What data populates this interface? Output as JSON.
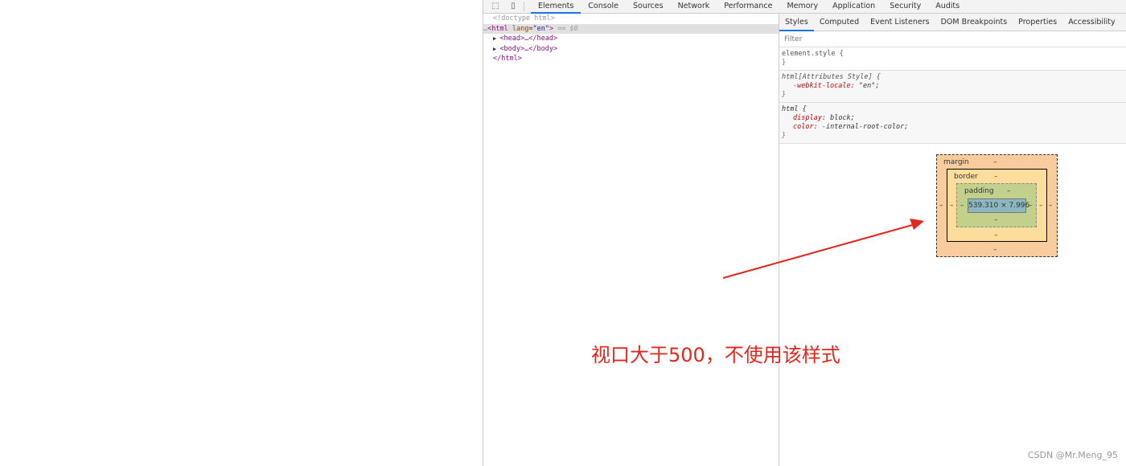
{
  "toolbar": {
    "icons": [
      "inspect-icon",
      "device-toggle-icon"
    ],
    "tabs": [
      "Elements",
      "Console",
      "Sources",
      "Network",
      "Performance",
      "Memory",
      "Application",
      "Security",
      "Audits"
    ],
    "active": "Elements"
  },
  "elements": {
    "doctype": "<!doctype html>",
    "html_open": "<html",
    "attr_name": "lang",
    "attr_value": "\"en\"",
    "html_close_bracket": ">",
    "selected_marker": "== $0",
    "head": "<head>…</head>",
    "body": "<body>…</body>",
    "html_end": "</html>"
  },
  "styles": {
    "tabs": [
      "Styles",
      "Computed",
      "Event Listeners",
      "DOM Breakpoints",
      "Properties",
      "Accessibility"
    ],
    "active": "Styles",
    "filter_placeholder": "Filter",
    "rules": [
      {
        "selector": "element.style {",
        "props": [],
        "close": "}"
      },
      {
        "selector": "html[Attributes Style] {",
        "props": [
          {
            "name": "-webkit-locale",
            "value": "\"en\";"
          }
        ],
        "close": "}"
      },
      {
        "selector": "html {",
        "props": [
          {
            "name": "display",
            "value": "block;"
          },
          {
            "name": "color",
            "value": "-internal-root-color;"
          }
        ],
        "close": "}"
      }
    ]
  },
  "box_model": {
    "margin_label": "margin",
    "border_label": "border",
    "padding_label": "padding",
    "dash": "–",
    "content": "539.310 × 7.996",
    "colors": {
      "margin": "#f9cc9d",
      "border": "#fddd9b",
      "padding": "#c3d08b",
      "content": "#8cb6c0"
    }
  },
  "annotation": {
    "text": "视口大于500，不使用该样式",
    "color": "#e5261d"
  },
  "watermark": "CSDN @Mr.Meng_95"
}
